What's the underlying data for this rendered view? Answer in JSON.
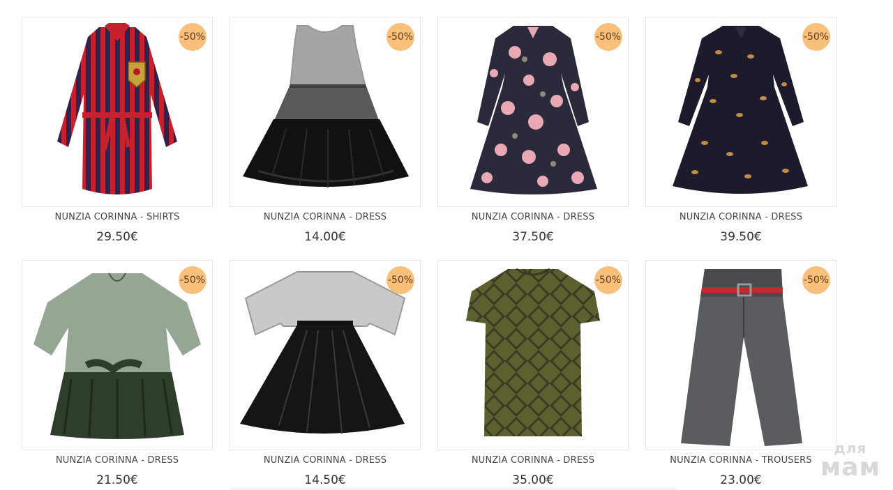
{
  "products": [
    {
      "name": "NUNZIA CORINNA - SHIRTS",
      "price": "29.50€",
      "badge": "-50%",
      "image": "striped-shirt-dress-image"
    },
    {
      "name": "NUNZIA CORINNA - DRESS",
      "price": "14.00€",
      "badge": "-50%",
      "image": "black-tulle-dress-image"
    },
    {
      "name": "NUNZIA CORINNA - DRESS",
      "price": "37.50€",
      "badge": "-50%",
      "image": "floral-dress-image"
    },
    {
      "name": "NUNZIA CORINNA - DRESS",
      "price": "39.50€",
      "badge": "-50%",
      "image": "navy-print-dress-image"
    },
    {
      "name": "NUNZIA CORINNA - DRESS",
      "price": "21.50€",
      "badge": "-50%",
      "image": "green-tulle-dress-image"
    },
    {
      "name": "NUNZIA CORINNA - DRESS",
      "price": "14.50€",
      "badge": "-50%",
      "image": "black-tulle-tshirt-dress-image"
    },
    {
      "name": "NUNZIA CORINNA - DRESS",
      "price": "35.00€",
      "badge": "-50%",
      "image": "olive-jacquard-dress-image"
    },
    {
      "name": "NUNZIA CORINNA - TROUSERS",
      "price": "23.00€",
      "badge": "-50%",
      "image": "grey-trousers-image"
    }
  ],
  "watermark": {
    "top": "для",
    "bottom": "мам"
  },
  "colors": {
    "badge": "#f8c07a",
    "text": "#444444",
    "border": "#e6e6e6"
  }
}
